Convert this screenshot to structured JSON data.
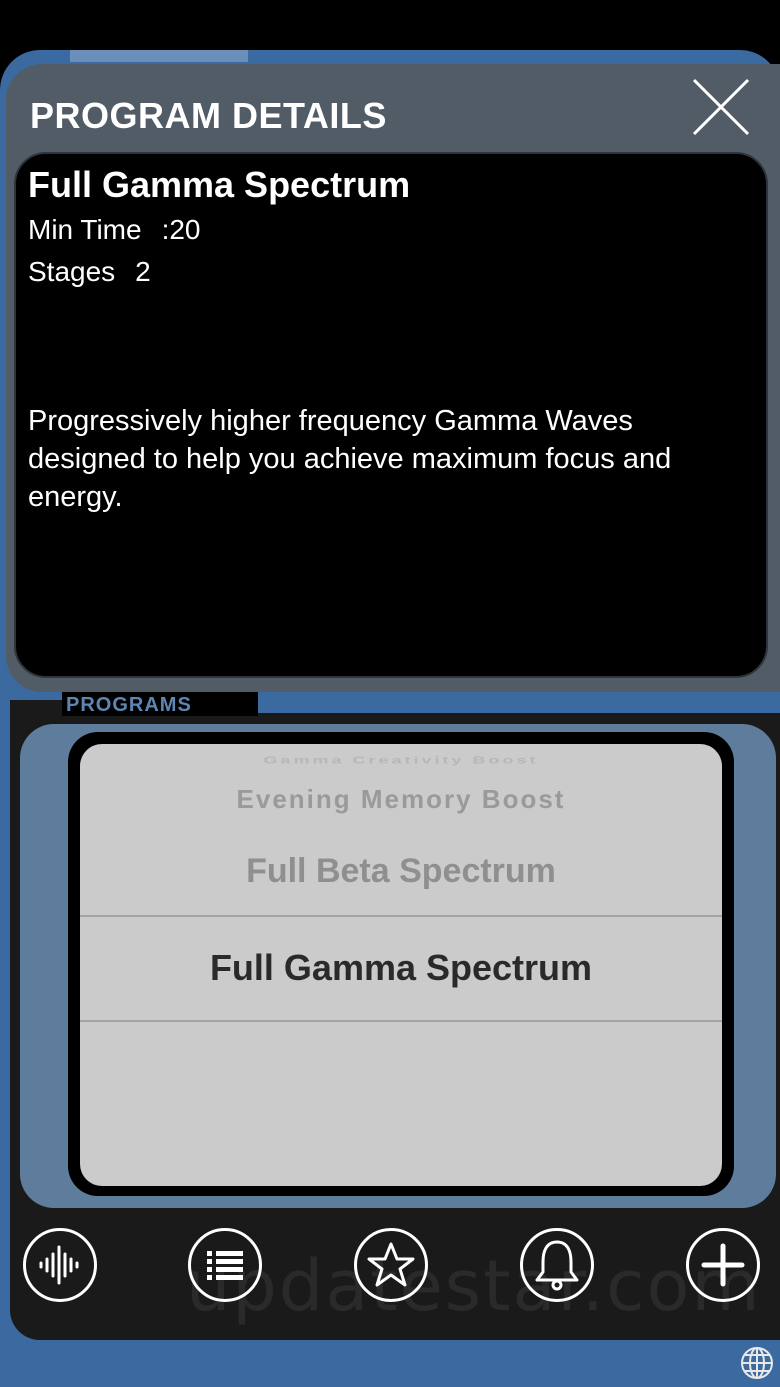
{
  "modal": {
    "title": "PROGRAM DETAILS",
    "close_icon": "close-icon",
    "program_name": "Full Gamma Spectrum",
    "min_time_label": "Min Time",
    "min_time_value": ":20",
    "stages_label": "Stages",
    "stages_value": "2",
    "description": "Progressively higher frequency Gamma Waves designed to help you achieve maximum focus and energy."
  },
  "programs": {
    "header": "PROGRAMS",
    "items": [
      "Gamma Creativity Boost",
      "Evening Memory Boost",
      "Full Beta Spectrum",
      "Full Gamma Spectrum"
    ],
    "selected": "Full Gamma Spectrum"
  },
  "tabbar": {
    "icons": [
      "waveform-icon",
      "list-icon",
      "star-icon",
      "bell-icon",
      "plus-icon"
    ]
  },
  "footer": {
    "globe_icon": "globe-icon"
  },
  "watermark": "updatestar.com",
  "colors": {
    "frame_blue": "#3a6aa0",
    "modal_gray": "#525c67",
    "picker_bg": "#cbcbcb",
    "panel_blue_gray": "#5e7c9c"
  }
}
